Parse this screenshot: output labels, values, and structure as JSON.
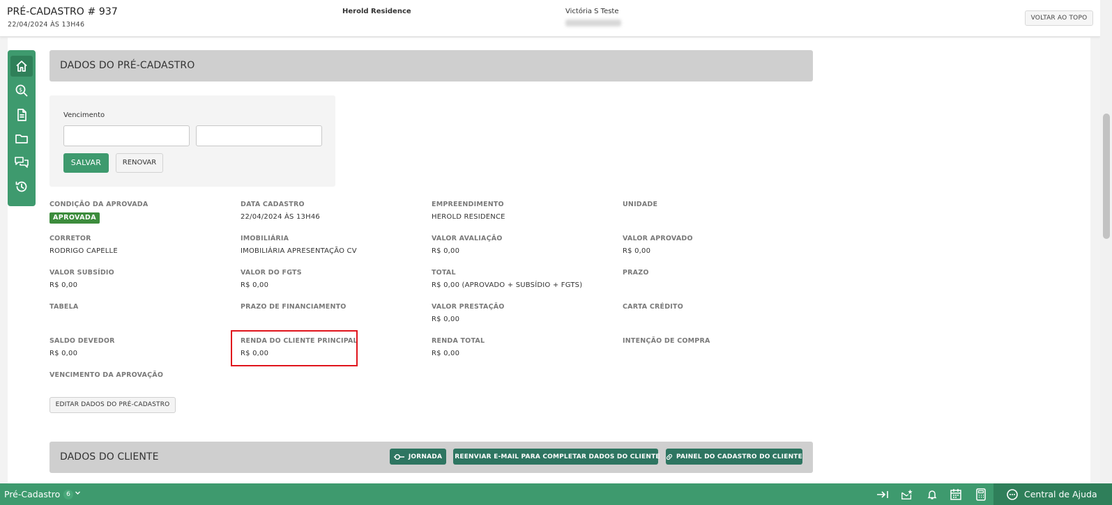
{
  "header": {
    "title": "PRÉ-CADASTRO # 937",
    "date": "22/04/2024 ÀS 13H46",
    "empreendimento": "Herold Residence",
    "client_name": "Victória S Teste",
    "back_to_top": "VOLTAR AO TOPO"
  },
  "sidebar": {
    "items": [
      {
        "icon": "home-icon",
        "active": true
      },
      {
        "icon": "search-dollar-icon"
      },
      {
        "icon": "document-icon"
      },
      {
        "icon": "folder-icon"
      },
      {
        "icon": "chat-icon"
      },
      {
        "icon": "history-icon"
      }
    ]
  },
  "section_pre": {
    "title": "DADOS DO PRÉ-CADASTRO"
  },
  "vencimento": {
    "label": "Vencimento",
    "input1_value": "",
    "input2_value": "",
    "save_label": "SALVAR",
    "renew_label": "RENOVAR"
  },
  "fields": {
    "condicao_label": "CONDIÇÃO DA APROVADA",
    "condicao_value": "APROVADA",
    "data_cadastro_label": "DATA CADASTRO",
    "data_cadastro_value": "22/04/2024 ÀS 13H46",
    "empreendimento_label": "EMPREENDIMENTO",
    "empreendimento_value": "HEROLD RESIDENCE",
    "unidade_label": "UNIDADE",
    "corretor_label": "CORRETOR",
    "corretor_value": "RODRIGO CAPELLE",
    "imobiliaria_label": "IMOBILIÁRIA",
    "imobiliaria_value": "IMOBILIÁRIA APRESENTAÇÃO CV",
    "valor_avaliacao_label": "VALOR AVALIAÇÃO",
    "valor_avaliacao_value": "R$ 0,00",
    "valor_aprovado_label": "VALOR APROVADO",
    "valor_aprovado_value": "R$ 0,00",
    "valor_subsidio_label": "VALOR SUBSÍDIO",
    "valor_subsidio_value": "R$ 0,00",
    "valor_fgts_label": "VALOR DO FGTS",
    "valor_fgts_value": "R$ 0,00",
    "total_label": "TOTAL",
    "total_value": "R$ 0,00 (APROVADO + SUBSÍDIO + FGTS)",
    "prazo_label": "PRAZO",
    "tabela_label": "TABELA",
    "prazo_financ_label": "PRAZO DE FINANCIAMENTO",
    "valor_prestacao_label": "VALOR PRESTAÇÃO",
    "valor_prestacao_value": "R$ 0,00",
    "carta_credito_label": "CARTA CRÉDITO",
    "saldo_devedor_label": "SALDO DEVEDOR",
    "saldo_devedor_value": "R$ 0,00",
    "renda_principal_label": "RENDA DO CLIENTE PRINCIPAL",
    "renda_principal_value": "R$ 0,00",
    "renda_total_label": "RENDA TOTAL",
    "renda_total_value": "R$ 0,00",
    "intencao_label": "INTENÇÃO DE COMPRA",
    "vencimento_aprov_label": "VENCIMENTO DA APROVAÇÃO"
  },
  "edit_button": "EDITAR DADOS DO PRÉ-CADASTRO",
  "section_cliente": {
    "title": "DADOS DO CLIENTE",
    "jornada": "JORNADA",
    "reenviar": "REENVIAR E-MAIL PARA COMPLETAR DADOS DO CLIENTE",
    "painel": "PAINEL DO CADASTRO DO CLIENTE"
  },
  "bottombar": {
    "title": "Pré-Cadastro",
    "count": "6",
    "help": "Central de Ajuda"
  },
  "colors": {
    "brand_green": "#3e9a6e",
    "dark_teal": "#2e7561",
    "highlight_red": "#e0141c"
  }
}
